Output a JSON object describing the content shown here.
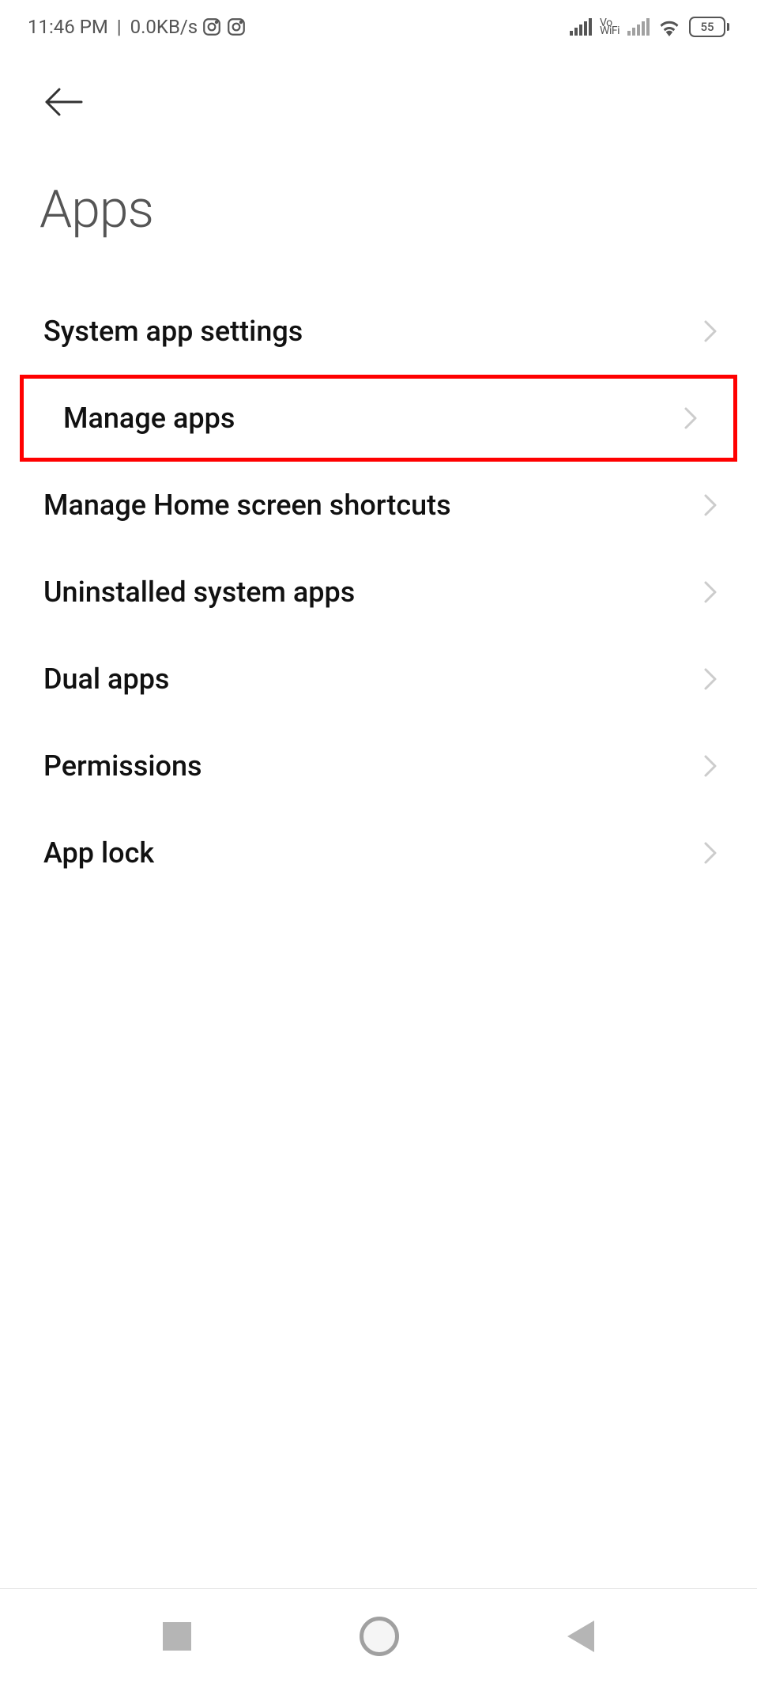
{
  "statusbar": {
    "time": "11:46 PM",
    "network_speed": "0.0KB/s",
    "vowifi": "Vo\nWiFi",
    "battery_level": "55"
  },
  "header": {
    "title": "Apps"
  },
  "list": {
    "items": [
      {
        "label": "System app settings",
        "highlighted": false
      },
      {
        "label": "Manage apps",
        "highlighted": true
      },
      {
        "label": "Manage Home screen shortcuts",
        "highlighted": false
      },
      {
        "label": "Uninstalled system apps",
        "highlighted": false
      },
      {
        "label": "Dual apps",
        "highlighted": false
      },
      {
        "label": "Permissions",
        "highlighted": false
      },
      {
        "label": "App lock",
        "highlighted": false
      }
    ]
  }
}
